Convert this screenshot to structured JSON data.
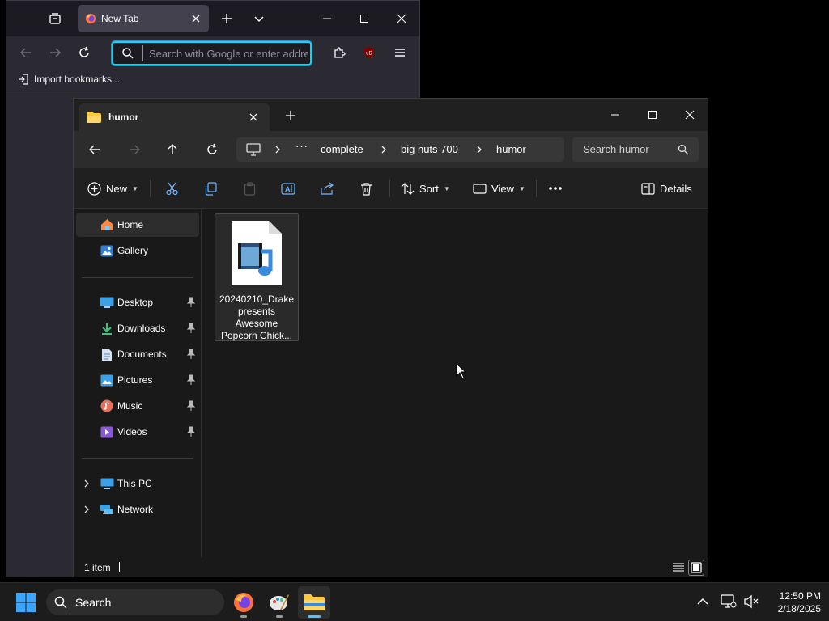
{
  "firefox": {
    "tab_title": "New Tab",
    "url_placeholder": "Search with Google or enter address",
    "bookmarks_import_label": "Import bookmarks...",
    "ublock_badge": "uD"
  },
  "explorer": {
    "tab_title": "humor",
    "breadcrumb": [
      "complete",
      "big nuts 700",
      "humor"
    ],
    "search_placeholder": "Search humor",
    "toolbar": {
      "new_label": "New",
      "sort_label": "Sort",
      "view_label": "View",
      "details_label": "Details"
    },
    "sidebar": {
      "home": "Home",
      "gallery": "Gallery",
      "desktop": "Desktop",
      "downloads": "Downloads",
      "documents": "Documents",
      "pictures": "Pictures",
      "music": "Music",
      "videos": "Videos",
      "this_pc": "This PC",
      "network": "Network"
    },
    "file": {
      "line1": "20240210_Drake",
      "line2": "presents",
      "line3": "Awesome",
      "line4": "Popcorn Chick..."
    },
    "status_count": "1 item"
  },
  "taskbar": {
    "search_label": "Search",
    "time": "12:50 PM",
    "date": "2/18/2025"
  },
  "colors": {
    "accent": "#4cc2ff",
    "firefox_focus": "#00ddff"
  }
}
